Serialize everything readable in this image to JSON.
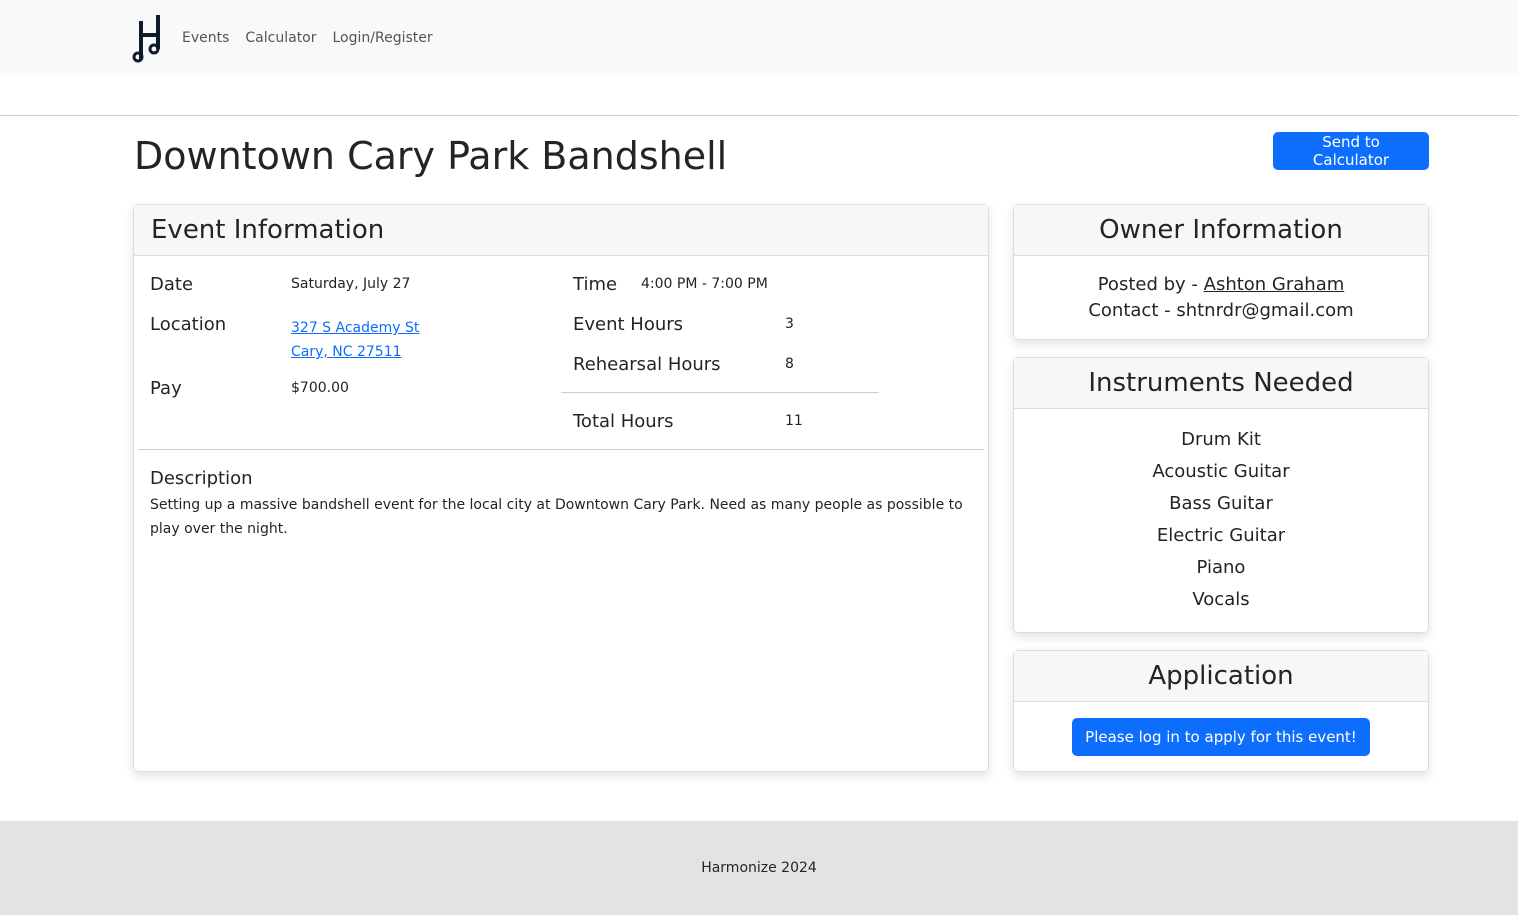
{
  "nav": {
    "links": [
      "Events",
      "Calculator",
      "Login/Register"
    ]
  },
  "page_title": "Downtown Cary Park Bandshell",
  "send_button": "Send to Calculator",
  "event": {
    "header": "Event Information",
    "date_label": "Date",
    "date": "Saturday, July 27",
    "location_label": "Location",
    "address1": "327 S Academy St",
    "address2": "Cary, NC 27511",
    "pay_label": "Pay",
    "pay": "$700.00",
    "time_label": "Time",
    "time": "4:00 PM - 7:00 PM",
    "event_hours_label": "Event Hours",
    "event_hours": "3",
    "rehearsal_label": "Rehearsal Hours",
    "rehearsal_hours": "8",
    "total_label": "Total Hours",
    "total_hours": "11",
    "desc_label": "Description",
    "description": "Setting up a massive bandshell event for the local city at Downtown Cary Park. Need as many people as possible to play over the night."
  },
  "owner": {
    "header": "Owner Information",
    "posted_prefix": "Posted by - ",
    "name": "Ashton Graham",
    "contact": "Contact - shtnrdr@gmail.com"
  },
  "instruments": {
    "header": "Instruments Needed",
    "items": [
      "Drum Kit",
      "Acoustic Guitar",
      "Bass Guitar",
      "Electric Guitar",
      "Piano",
      "Vocals"
    ]
  },
  "application": {
    "header": "Application",
    "button": "Please log in to apply for this event!"
  },
  "footer": "Harmonize 2024"
}
